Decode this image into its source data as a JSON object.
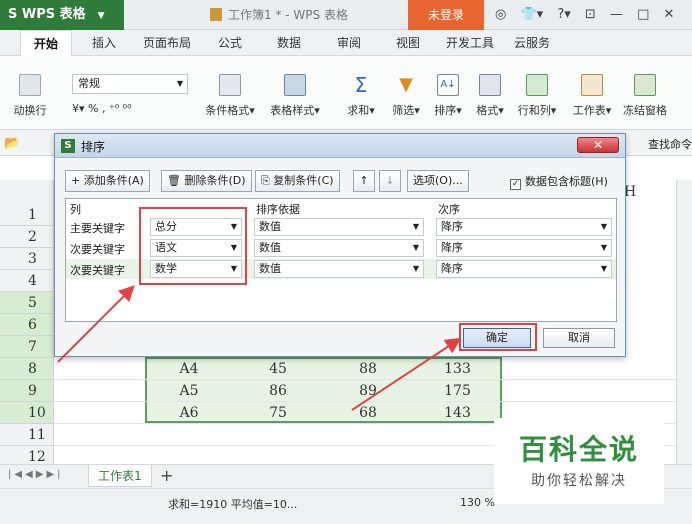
{
  "app": {
    "logo_text": "S WPS 表格",
    "doc_title": "工作簿1 * - WPS 表格",
    "login_label": "未登录",
    "top_icons": [
      "◎",
      "👕▾",
      "?▾",
      "⊡",
      "—",
      "□",
      "✕"
    ]
  },
  "tabs": [
    "开始",
    "插入",
    "页面布局",
    "公式",
    "数据",
    "审阅",
    "视图",
    "开发工具",
    "云服务"
  ],
  "ribbon": {
    "wrap_label": "动换行",
    "number_format": "常规",
    "percent_tools": "¥▾ %  ,  ⁺⁰ ⁰⁰",
    "cond_format": "条件格式▾",
    "table_style": "表格样式▾",
    "sum": "求和▾",
    "filter": "筛选▾",
    "sort": "排序▾",
    "format": "格式▾",
    "rowcol": "行和列▾",
    "worksheet": "工作表▾",
    "freeze": "冻结窗格",
    "find": "查找命令"
  },
  "grid": {
    "row_numbers": [
      "1",
      "2",
      "3",
      "4",
      "5",
      "6",
      "7",
      "8",
      "9",
      "10",
      "11",
      "12"
    ],
    "col_h": "H",
    "rows": [
      {
        "id": "A4",
        "v1": "45",
        "v2": "88",
        "total": "133"
      },
      {
        "id": "A5",
        "v1": "86",
        "v2": "89",
        "total": "175"
      },
      {
        "id": "A6",
        "v1": "75",
        "v2": "68",
        "total": "143"
      }
    ]
  },
  "dialog": {
    "title": "排序",
    "close": "✕",
    "add_condition": "+ 添加条件(A)",
    "delete_condition": "删除条件(D)",
    "copy_condition": "复制条件(C)",
    "move_up": "↑",
    "move_down": "↓",
    "options": "选项(O)...",
    "header_checkbox_label": "数据包含标题(H)",
    "header_checkbox_checked": "✓",
    "col_header": "列",
    "basis_header": "排序依据",
    "order_header": "次序",
    "conditions": [
      {
        "label": "主要关键字",
        "column": "总分",
        "basis": "数值",
        "order": "降序"
      },
      {
        "label": "次要关键字",
        "column": "语文",
        "basis": "数值",
        "order": "降序"
      },
      {
        "label": "次要关键字",
        "column": "数学",
        "basis": "数值",
        "order": "降序"
      }
    ],
    "ok": "确定",
    "cancel": "取消"
  },
  "sheet": {
    "tab_label": "工作表1",
    "add": "+"
  },
  "status": {
    "summary": "求和=1910  平均值=10...",
    "zoom": "130 %"
  },
  "watermark": {
    "title": "百科全说",
    "subtitle": "助你轻松解决"
  },
  "colors": {
    "accent_green": "#2f7b3a",
    "login_orange": "#e8652f",
    "highlight_red": "#e04343",
    "selection_green": "#e6f2e2"
  }
}
